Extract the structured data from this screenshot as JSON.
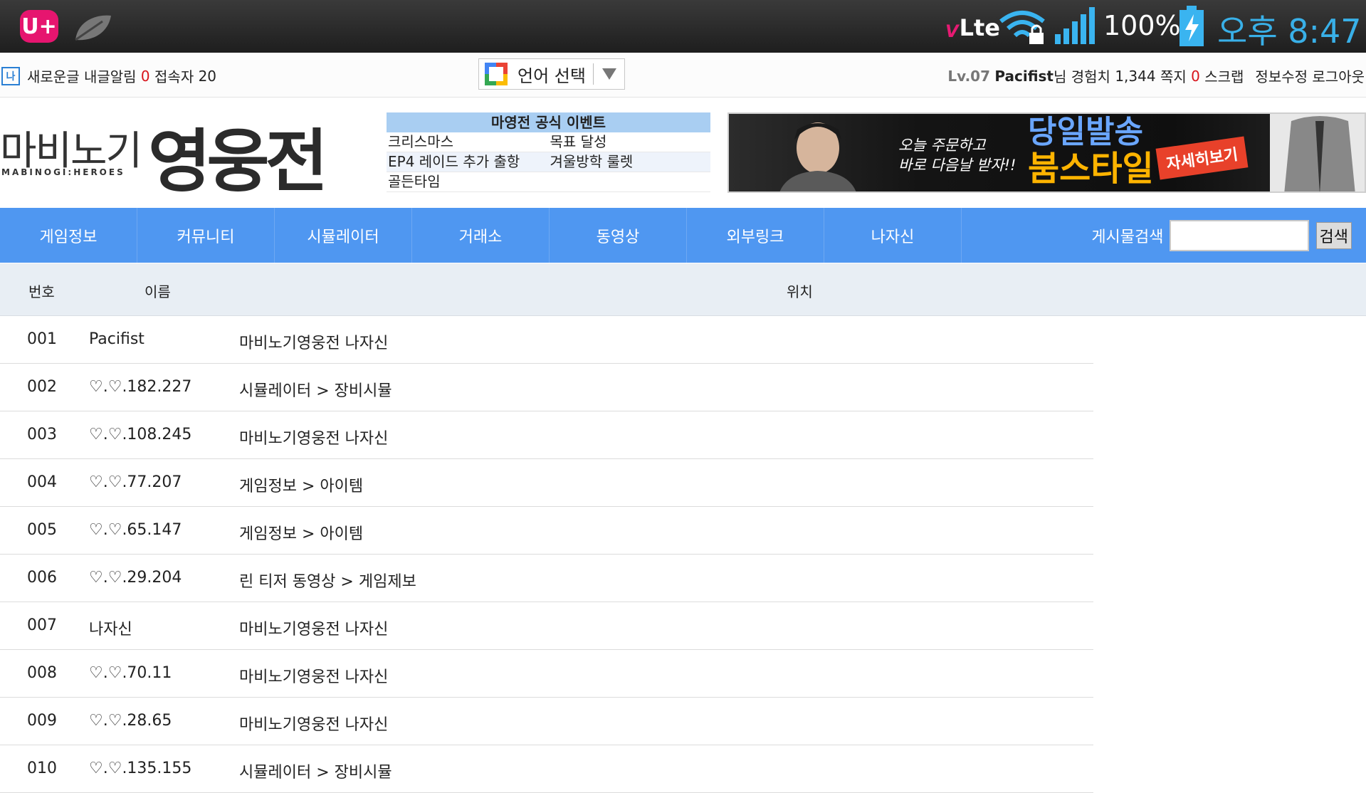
{
  "statusbar": {
    "carrier_icon": "U+",
    "volte_v": "V",
    "volte_lte": "Lte",
    "battery_percent": "100%",
    "time": "오후 8:47",
    "icons": [
      "uplus-logo-icon",
      "leaf-icon",
      "volte-icon",
      "wifi-lock-icon",
      "signal-icon",
      "battery-charging-icon"
    ],
    "time_color": "#39b0e8"
  },
  "topbar": {
    "logo_text": "나",
    "notify_label": "새로운글 내글알림",
    "notify_count": "0",
    "visitors_label": "접속자",
    "visitors_count": "20",
    "language_label": "언어 선택",
    "level": "Lv.07",
    "nickname": "Pacifist",
    "exp_label": "님 경험치",
    "exp_value": "1,344",
    "memo_label": "쪽지",
    "memo_count": "0",
    "scrap_label": "스크랩",
    "edit_label": "정보수정",
    "logout_label": "로그아웃"
  },
  "logo": {
    "small": "마비노기",
    "sub": "MABINOGI:HEROES",
    "big": "영웅전"
  },
  "events": {
    "title": "마영전 공식 이벤트",
    "rows": [
      [
        "크리스마스",
        "목표 달성"
      ],
      [
        "EP4 레이드 추가 출항",
        "겨울방학 룰렛"
      ],
      [
        "골든타임",
        ""
      ]
    ]
  },
  "ad": {
    "line1": "오늘 주문하고",
    "line2": "바로 다음날 받자!!",
    "headline1": "당일발송",
    "headline2": "붐스타일",
    "button": "자세히보기"
  },
  "nav": {
    "items": [
      "게임정보",
      "커뮤니티",
      "시뮬레이터",
      "거래소",
      "동영상",
      "외부링크",
      "나자신"
    ],
    "search_label": "게시물검색",
    "search_value": "",
    "search_button": "검색",
    "color": "#4f97f1"
  },
  "table": {
    "headers": {
      "no": "번호",
      "name": "이름",
      "location": "위치"
    },
    "rows": [
      {
        "no": "001",
        "name": "Pacifist",
        "location": "마비노기영웅전 나자신"
      },
      {
        "no": "002",
        "name": "♡.♡.182.227",
        "location": "시뮬레이터 > 장비시뮬"
      },
      {
        "no": "003",
        "name": "♡.♡.108.245",
        "location": "마비노기영웅전 나자신"
      },
      {
        "no": "004",
        "name": "♡.♡.77.207",
        "location": "게임정보 > 아이템"
      },
      {
        "no": "005",
        "name": "♡.♡.65.147",
        "location": "게임정보 > 아이템"
      },
      {
        "no": "006",
        "name": "♡.♡.29.204",
        "location": "린 티저 동영상 > 게임제보"
      },
      {
        "no": "007",
        "name": "나자신",
        "location": "마비노기영웅전 나자신"
      },
      {
        "no": "008",
        "name": "♡.♡.70.11",
        "location": "마비노기영웅전 나자신"
      },
      {
        "no": "009",
        "name": "♡.♡.28.65",
        "location": "마비노기영웅전 나자신"
      },
      {
        "no": "010",
        "name": "♡.♡.135.155",
        "location": "시뮬레이터 > 장비시뮬"
      }
    ]
  }
}
